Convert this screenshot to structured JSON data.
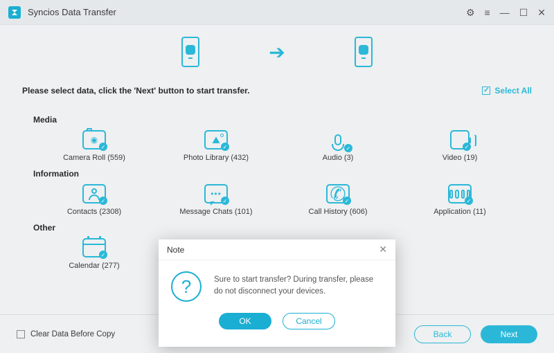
{
  "app": {
    "title": "Syncios Data Transfer"
  },
  "instruction": "Please select data, click the 'Next' button to start transfer.",
  "select_all": "Select All",
  "sections": {
    "media": {
      "title": "Media",
      "items": [
        {
          "label": "Camera Roll (559)"
        },
        {
          "label": "Photo Library (432)"
        },
        {
          "label": "Audio (3)"
        },
        {
          "label": "Video (19)"
        }
      ]
    },
    "information": {
      "title": "Information",
      "items": [
        {
          "label": "Contacts (2308)"
        },
        {
          "label": "Message Chats (101)"
        },
        {
          "label": "Call History (606)"
        },
        {
          "label": "Application (11)"
        }
      ]
    },
    "other": {
      "title": "Other",
      "items": [
        {
          "label": "Calendar (277)"
        }
      ]
    }
  },
  "footer": {
    "clear_data": "Clear Data Before Copy",
    "back": "Back",
    "next": "Next"
  },
  "modal": {
    "title": "Note",
    "message": "Sure to start transfer? During transfer, please do not disconnect your devices.",
    "ok": "OK",
    "cancel": "Cancel"
  }
}
